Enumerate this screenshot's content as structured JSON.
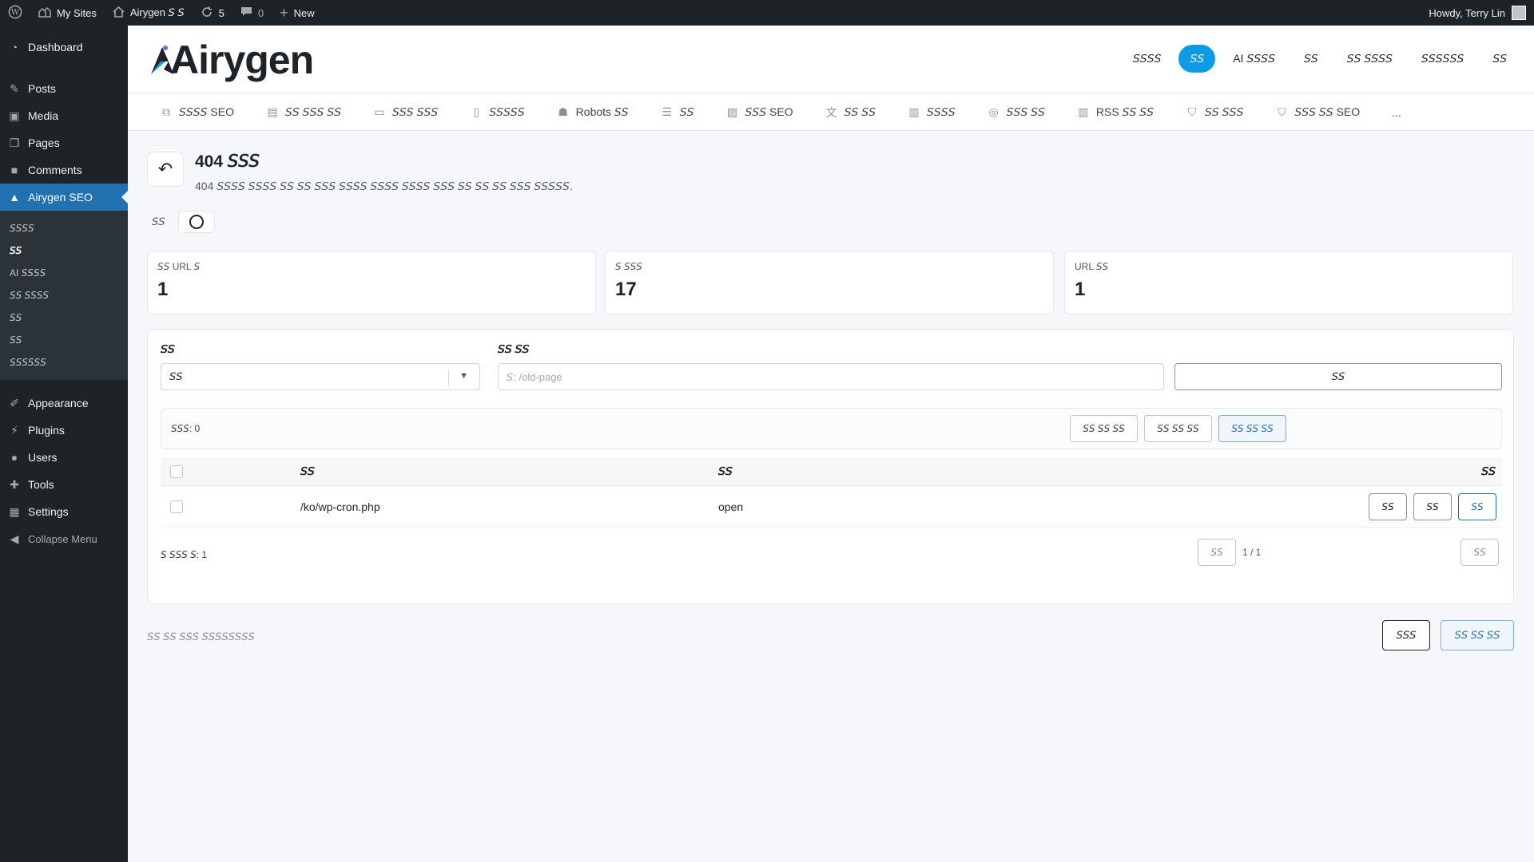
{
  "adminbar": {
    "my_sites": "My Sites",
    "site_name": "Airygen 𝘚 𝘚",
    "updates_count": "5",
    "comments_count": "0",
    "new_label": "New",
    "howdy": "Howdy, Terry Lin"
  },
  "sidebar": {
    "items": [
      {
        "label": "Dashboard",
        "icon": "dashboard-icon"
      },
      {
        "label": "Posts",
        "icon": "pin-icon"
      },
      {
        "label": "Media",
        "icon": "media-icon"
      },
      {
        "label": "Pages",
        "icon": "pages-icon"
      },
      {
        "label": "Comments",
        "icon": "comment-icon"
      },
      {
        "label": "Airygen SEO",
        "icon": "airygen-icon"
      }
    ],
    "submenu": [
      "𝘚𝘚𝘚𝘚",
      "𝘚𝘚",
      "AI 𝘚𝘚𝘚𝘚",
      "𝘚𝘚 𝘚𝘚𝘚𝘚",
      "𝘚𝘚",
      "𝘚𝘚",
      "𝘚𝘚𝘚𝘚𝘚𝘚"
    ],
    "items2": [
      {
        "label": "Appearance",
        "icon": "brush-icon"
      },
      {
        "label": "Plugins",
        "icon": "plugin-icon"
      },
      {
        "label": "Users",
        "icon": "user-icon"
      },
      {
        "label": "Tools",
        "icon": "wrench-icon"
      },
      {
        "label": "Settings",
        "icon": "settings-icon"
      }
    ],
    "collapse": "Collapse Menu"
  },
  "header": {
    "logo": "Airygen",
    "nav": [
      "𝘚𝘚𝘚𝘚",
      "𝘚𝘚",
      "AI 𝘚𝘚𝘚𝘚",
      "𝘚𝘚",
      "𝘚𝘚 𝘚𝘚𝘚𝘚",
      "𝘚𝘚𝘚𝘚𝘚𝘚",
      "𝘚𝘚"
    ]
  },
  "subnav": [
    {
      "label": "𝘚𝘚𝘚𝘚 SEO",
      "icon": "copy-icon"
    },
    {
      "label": "𝘚𝘚 𝘚𝘚𝘚 𝘚𝘚",
      "icon": "card-icon"
    },
    {
      "label": "𝘚𝘚𝘚 𝘚𝘚𝘚",
      "icon": "message-icon"
    },
    {
      "label": "𝘚𝘚𝘚𝘚𝘚",
      "icon": "file-icon"
    },
    {
      "label": "Robots 𝘚𝘚",
      "icon": "robot-icon"
    },
    {
      "label": "𝘚𝘚",
      "icon": "list-icon"
    },
    {
      "label": "𝘚𝘚𝘚 SEO",
      "icon": "image-icon"
    },
    {
      "label": "𝘚𝘚 𝘚𝘚",
      "icon": "translate-icon"
    },
    {
      "label": "𝘚𝘚𝘚𝘚",
      "icon": "map-icon"
    },
    {
      "label": "𝘚𝘚𝘚 𝘚𝘚",
      "icon": "check-circle-icon"
    },
    {
      "label": "RSS 𝘚𝘚 𝘚𝘚",
      "icon": "rss-map-icon"
    },
    {
      "label": "𝘚𝘚 𝘚𝘚𝘚",
      "icon": "shield-icon"
    },
    {
      "label": "𝘚𝘚𝘚 𝘚𝘚 SEO",
      "icon": "shield-check-icon"
    },
    {
      "label": "...",
      "icon": "more-icon"
    }
  ],
  "page": {
    "title": "404 𝘚𝘚𝘚",
    "description": "404 𝘚𝘚𝘚𝘚 𝘚𝘚𝘚𝘚 𝘚𝘚 𝘚𝘚 𝘚𝘚𝘚 𝘚𝘚𝘚𝘚 𝘚𝘚𝘚𝘚 𝘚𝘚𝘚𝘚 𝘚𝘚𝘚 𝘚𝘚 𝘚𝘚 𝘚𝘚 𝘚𝘚𝘚 𝘚𝘚𝘚𝘚𝘚.",
    "toggle_label": "𝘚𝘚"
  },
  "stats": [
    {
      "label": "𝘚𝘚 URL 𝘚",
      "value": "1"
    },
    {
      "label": "𝘚 𝘚𝘚𝘚",
      "value": "17"
    },
    {
      "label": "URL 𝘚𝘚",
      "value": "1"
    }
  ],
  "filters": {
    "status_label": "𝘚𝘚",
    "status_value": "𝘚𝘚",
    "search_label": "𝘚𝘚 𝘚𝘚",
    "search_placeholder": "𝘚: /old-page",
    "search_button": "𝘚𝘚"
  },
  "bulk": {
    "selected": "𝘚𝘚𝘚: 0",
    "buttons": [
      "𝘚𝘚 𝘚𝘚 𝘚𝘚",
      "𝘚𝘚 𝘚𝘚 𝘚𝘚",
      "𝘚𝘚 𝘚𝘚 𝘚𝘚"
    ]
  },
  "table": {
    "headers": [
      "𝘚𝘚",
      "𝘚𝘚",
      "𝘚𝘚"
    ],
    "rows": [
      {
        "path": "/ko/wp-cron.php",
        "status": "open",
        "actions": [
          "𝘚𝘚",
          "𝘚𝘚",
          "𝘚𝘚"
        ]
      }
    ]
  },
  "pagination": {
    "total": "𝘚 𝘚𝘚𝘚 𝘚: 1",
    "prev": "𝘚𝘚",
    "info": "1 / 1",
    "next": "𝘚𝘚"
  },
  "footer": {
    "note": "𝘚𝘚 𝘚𝘚 𝘚𝘚𝘚 𝘚𝘚𝘚𝘚𝘚𝘚𝘚𝘚",
    "secondary": "𝘚𝘚𝘚",
    "primary": "𝘚𝘚 𝘚𝘚 𝘚𝘚"
  },
  "colors": {
    "accent": "#0e9be5",
    "admin_dark": "#1d2327",
    "wp_blue": "#2271b1"
  }
}
